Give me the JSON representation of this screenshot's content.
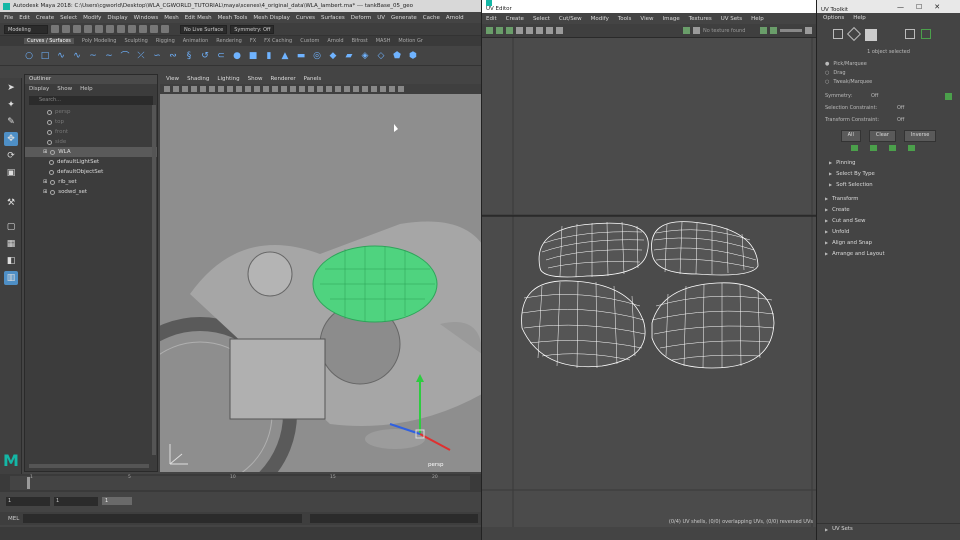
{
  "maya": {
    "title": "Autodesk Maya 2018: C:\\Users\\cgworld\\Desktop\\WLA_CGWORLD_TUTORIAL\\maya\\scenes\\4_original_data\\WLA_lambert.ma* --- tankBase_05_geo",
    "menus": [
      "File",
      "Edit",
      "Create",
      "Select",
      "Modify",
      "Display",
      "Windows",
      "Mesh",
      "Edit Mesh",
      "Mesh Tools",
      "Mesh Display",
      "Curves",
      "Surfaces",
      "Deform",
      "UV",
      "Generate",
      "Cache",
      "Arnold"
    ],
    "mode_dropdown": "Modeling",
    "live_surface": "No Live Surface",
    "symmetry": "Symmetry: Off",
    "shelf_tabs": [
      "Curves / Surfaces",
      "Poly Modeling",
      "Sculpting",
      "Rigging",
      "Animation",
      "Rendering",
      "FX",
      "FX Caching",
      "Custom",
      "Arnold",
      "Bifrost",
      "MASH",
      "Motion Gr"
    ],
    "outliner": {
      "title": "Outliner",
      "menus": [
        "Display",
        "Show",
        "Help"
      ],
      "search_placeholder": "Search...",
      "items": [
        {
          "label": "persp",
          "dim": true
        },
        {
          "label": "top",
          "dim": true
        },
        {
          "label": "front",
          "dim": true
        },
        {
          "label": "side",
          "dim": true
        },
        {
          "label": "WLA",
          "dim": false,
          "selected": true
        },
        {
          "label": "defaultLightSet",
          "dim": false
        },
        {
          "label": "defaultObjectSet",
          "dim": false
        },
        {
          "label": "rib_set",
          "dim": false
        },
        {
          "label": "sodwd_set",
          "dim": false
        }
      ]
    },
    "viewport": {
      "menus": [
        "View",
        "Shading",
        "Lighting",
        "Show",
        "Renderer",
        "Panels"
      ],
      "camera_label": "persp"
    },
    "timeline": {
      "ticks": [
        "1",
        "5",
        "10",
        "15",
        "20"
      ]
    },
    "range": {
      "start": "1",
      "start2": "1",
      "current": "1",
      "end_label": "1"
    },
    "command_label": "MEL"
  },
  "uv_editor": {
    "title": "UV Editor",
    "menus": [
      "Edit",
      "Create",
      "Select",
      "Cut/Sew",
      "Modify",
      "Tools",
      "View",
      "Image",
      "Textures",
      "UV Sets",
      "Help"
    ],
    "texture_label": "No texture found",
    "status": "(0/4) UV shells, (0/0) overlapping UVs, (0/0) reversed UVs"
  },
  "uv_toolkit": {
    "title": "UV Toolkit",
    "menus": [
      "Options",
      "Help"
    ],
    "selection_info": "1 object selected",
    "modes": [
      "Pick/Marquee",
      "Drag",
      "Tweak/Marquee"
    ],
    "symmetry_label": "Symmetry:",
    "symmetry_value": "Off",
    "selection_constraint_label": "Selection Constraint:",
    "selection_constraint_value": "Off",
    "transform_constraint_label": "Transform Constraint:",
    "transform_constraint_value": "Off",
    "buttons": [
      "All",
      "Clear",
      "Inverse"
    ],
    "subsections": [
      "Pinning",
      "Select By Type",
      "Soft Selection"
    ],
    "sections": [
      "Transform",
      "Create",
      "Cut and Sew",
      "Unfold",
      "Align and Snap",
      "Arrange and Layout"
    ],
    "bottom_section": "UV Sets"
  },
  "colors": {
    "accent": "#4e8fc6",
    "selection_green": "#3ee07a",
    "brand": "#14b7a6"
  }
}
